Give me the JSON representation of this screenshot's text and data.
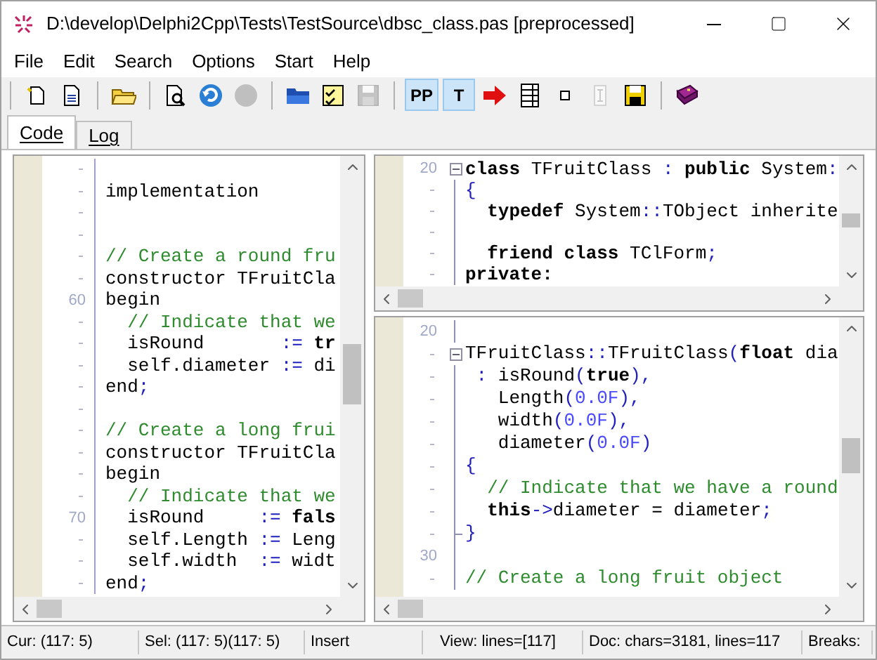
{
  "window": {
    "title": "D:\\develop\\Delphi2Cpp\\Tests\\TestSource\\dbsc_class.pas [preprocessed]"
  },
  "menu": [
    "File",
    "Edit",
    "Search",
    "Options",
    "Start",
    "Help"
  ],
  "toolbar": [
    {
      "kind": "new",
      "disabled": false
    },
    {
      "kind": "new-template",
      "disabled": false
    },
    {
      "kind": "sep"
    },
    {
      "kind": "open",
      "disabled": false
    },
    {
      "kind": "sep"
    },
    {
      "kind": "preview",
      "disabled": false
    },
    {
      "kind": "undo",
      "disabled": false
    },
    {
      "kind": "stop",
      "disabled": true
    },
    {
      "kind": "sep"
    },
    {
      "kind": "folder",
      "disabled": false
    },
    {
      "kind": "check",
      "disabled": false
    },
    {
      "kind": "save",
      "disabled": true
    },
    {
      "kind": "sep"
    },
    {
      "kind": "toggle",
      "label": "PP",
      "selected": true
    },
    {
      "kind": "toggle",
      "label": "T",
      "selected": true
    },
    {
      "kind": "run",
      "disabled": false
    },
    {
      "kind": "list",
      "disabled": false
    },
    {
      "kind": "small",
      "disabled": false
    },
    {
      "kind": "cursor",
      "disabled": true
    },
    {
      "kind": "save-as",
      "disabled": false
    },
    {
      "kind": "sep"
    },
    {
      "kind": "help",
      "disabled": false
    }
  ],
  "tabs": [
    {
      "label": "Code",
      "selected": true
    },
    {
      "label": "Log",
      "selected": false
    }
  ],
  "source_pane": {
    "folding": false,
    "lines": [
      {
        "marker": true
      },
      {
        "marker": true,
        "tokens": [
          {
            "kind": "id",
            "text": "implementation"
          }
        ]
      },
      {
        "marker": true
      },
      {
        "marker": true
      },
      {
        "marker": true,
        "tokens": [
          {
            "kind": "cmt",
            "text": "// Create a round fru"
          }
        ]
      },
      {
        "marker": true,
        "tokens": [
          {
            "kind": "id",
            "text": "constructor TFruitCla"
          }
        ]
      },
      {
        "number": "60",
        "tokens": [
          {
            "kind": "id",
            "text": "begin"
          }
        ]
      },
      {
        "marker": true,
        "tokens": [
          {
            "kind": "cmt",
            "text": "  // Indicate that we"
          }
        ]
      },
      {
        "marker": true,
        "tokens": [
          {
            "kind": "id",
            "text": "  isRound       "
          },
          {
            "kind": "sym",
            "text": ":="
          },
          {
            "kind": "kw",
            "text": " tr"
          }
        ]
      },
      {
        "marker": true,
        "tokens": [
          {
            "kind": "id",
            "text": "  self.diameter "
          },
          {
            "kind": "sym",
            "text": ":="
          },
          {
            "kind": "id",
            "text": " di"
          }
        ]
      },
      {
        "marker": true,
        "tokens": [
          {
            "kind": "id",
            "text": "end"
          },
          {
            "kind": "sym",
            "text": ";"
          }
        ]
      },
      {
        "marker": true
      },
      {
        "marker": true,
        "tokens": [
          {
            "kind": "cmt",
            "text": "// Create a long frui"
          }
        ]
      },
      {
        "marker": true,
        "tokens": [
          {
            "kind": "id",
            "text": "constructor TFruitCla"
          }
        ]
      },
      {
        "marker": true,
        "tokens": [
          {
            "kind": "id",
            "text": "begin"
          }
        ]
      },
      {
        "marker": true,
        "tokens": [
          {
            "kind": "cmt",
            "text": "  // Indicate that we"
          }
        ]
      },
      {
        "number": "70",
        "tokens": [
          {
            "kind": "id",
            "text": "  isRound     "
          },
          {
            "kind": "sym",
            "text": ":="
          },
          {
            "kind": "kw",
            "text": " fals"
          }
        ]
      },
      {
        "marker": true,
        "tokens": [
          {
            "kind": "id",
            "text": "  self.Length "
          },
          {
            "kind": "sym",
            "text": ":="
          },
          {
            "kind": "id",
            "text": " Leng"
          }
        ]
      },
      {
        "marker": true,
        "tokens": [
          {
            "kind": "id",
            "text": "  self.width  "
          },
          {
            "kind": "sym",
            "text": ":="
          },
          {
            "kind": "id",
            "text": " widt"
          }
        ]
      },
      {
        "marker": true,
        "tokens": [
          {
            "kind": "id",
            "text": "end"
          },
          {
            "kind": "sym",
            "text": ";"
          }
        ]
      }
    ]
  },
  "header_pane": {
    "folding": true,
    "lines": [
      {
        "number": "20",
        "fold_start": true,
        "tokens": [
          {
            "kind": "kw",
            "text": "class"
          },
          {
            "kind": "id",
            "text": " TFruitClass "
          },
          {
            "kind": "sym",
            "text": ":"
          },
          {
            "kind": "kw",
            "text": " public"
          },
          {
            "kind": "id",
            "text": " System"
          },
          {
            "kind": "sym",
            "text": ":"
          }
        ]
      },
      {
        "marker": true,
        "tokens": [
          {
            "kind": "sym",
            "text": "{"
          }
        ]
      },
      {
        "marker": true,
        "tokens": [
          {
            "kind": "kw",
            "text": "  typedef"
          },
          {
            "kind": "id",
            "text": " System"
          },
          {
            "kind": "sym",
            "text": "::"
          },
          {
            "kind": "id",
            "text": "TObject inherite"
          }
        ]
      },
      {
        "marker": true
      },
      {
        "marker": true,
        "tokens": [
          {
            "kind": "kw",
            "text": "  friend class"
          },
          {
            "kind": "id",
            "text": " TClForm"
          },
          {
            "kind": "sym",
            "text": ";"
          }
        ]
      },
      {
        "marker": true,
        "tokens": [
          {
            "kind": "kw",
            "text": "private:"
          }
        ]
      }
    ]
  },
  "impl_pane": {
    "folding": true,
    "lines": [
      {
        "number": "20"
      },
      {
        "marker": true,
        "fold_start": true,
        "tokens": [
          {
            "kind": "id",
            "text": "TFruitClass"
          },
          {
            "kind": "sym",
            "text": "::"
          },
          {
            "kind": "id",
            "text": "TFruitClass"
          },
          {
            "kind": "sym",
            "text": "("
          },
          {
            "kind": "kw",
            "text": "float"
          },
          {
            "kind": "id",
            "text": " dia"
          }
        ]
      },
      {
        "marker": true,
        "tokens": [
          {
            "kind": "sym",
            "text": " :"
          },
          {
            "kind": "id",
            "text": " isRound"
          },
          {
            "kind": "sym",
            "text": "("
          },
          {
            "kind": "kw",
            "text": "true"
          },
          {
            "kind": "sym",
            "text": "),"
          }
        ]
      },
      {
        "marker": true,
        "tokens": [
          {
            "kind": "id",
            "text": "   Length"
          },
          {
            "kind": "sym",
            "text": "("
          },
          {
            "kind": "num",
            "text": "0.0F"
          },
          {
            "kind": "sym",
            "text": "),"
          }
        ]
      },
      {
        "marker": true,
        "tokens": [
          {
            "kind": "id",
            "text": "   width"
          },
          {
            "kind": "sym",
            "text": "("
          },
          {
            "kind": "num",
            "text": "0.0F"
          },
          {
            "kind": "sym",
            "text": "),"
          }
        ]
      },
      {
        "marker": true,
        "tokens": [
          {
            "kind": "id",
            "text": "   diameter"
          },
          {
            "kind": "sym",
            "text": "("
          },
          {
            "kind": "num",
            "text": "0.0F"
          },
          {
            "kind": "sym",
            "text": ")"
          }
        ]
      },
      {
        "marker": true,
        "tokens": [
          {
            "kind": "sym",
            "text": "{"
          }
        ]
      },
      {
        "marker": true,
        "tokens": [
          {
            "kind": "cmt",
            "text": "  // Indicate that we have a round"
          }
        ]
      },
      {
        "marker": true,
        "tokens": [
          {
            "kind": "kw",
            "text": "  this"
          },
          {
            "kind": "sym",
            "text": "->"
          },
          {
            "kind": "id",
            "text": "diameter = diameter"
          },
          {
            "kind": "sym",
            "text": ";"
          }
        ]
      },
      {
        "marker": true,
        "fold_end": true,
        "tokens": [
          {
            "kind": "sym",
            "text": "}"
          }
        ]
      },
      {
        "number": "30"
      },
      {
        "marker": true,
        "tokens": [
          {
            "kind": "cmt",
            "text": "// Create a long fruit object"
          }
        ]
      }
    ]
  },
  "status_bar": [
    "Cur: (117: 5)",
    "Sel: (117: 5)(117: 5)",
    "Insert",
    "View: lines=[117]",
    "Doc: chars=3181, lines=117",
    "Breaks:"
  ]
}
